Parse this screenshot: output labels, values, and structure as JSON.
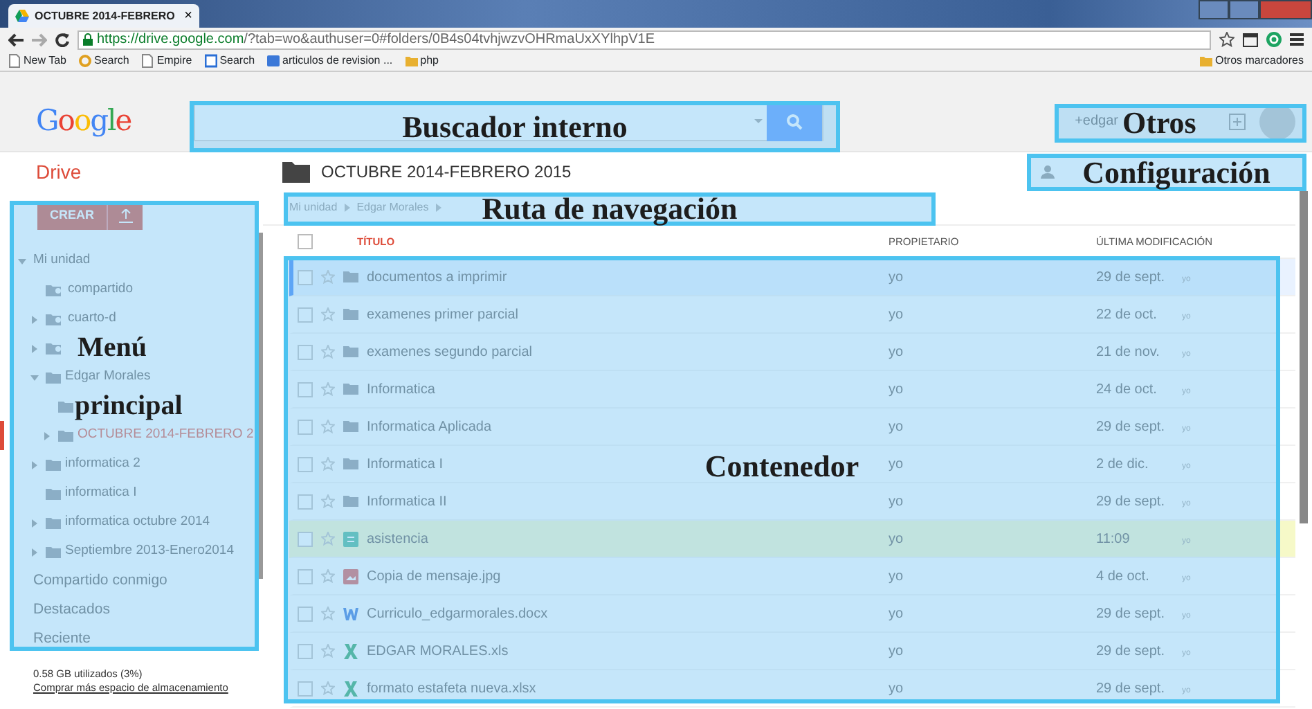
{
  "browser": {
    "tab": {
      "title": "OCTUBRE 2014-FEBRERO",
      "close": "×"
    },
    "url": {
      "host": "https://drive.google.com",
      "path": "/?tab=wo&authuser=0#folders/0B4s04tvhjwzvOHRmaUxXYlhpV1E"
    },
    "bookmarks": [
      {
        "label": "New Tab",
        "kind": "page"
      },
      {
        "label": "Search",
        "kind": "circle"
      },
      {
        "label": "Empire",
        "kind": "page"
      },
      {
        "label": "Search",
        "kind": "board"
      },
      {
        "label": "articulos de revision ...",
        "kind": "app"
      },
      {
        "label": "php",
        "kind": "folder"
      }
    ],
    "other_bookmarks": "Otros marcadores"
  },
  "header": {
    "logo": "Google",
    "user": "+edgar"
  },
  "app": {
    "name": "Drive",
    "folder_title": "OCTUBRE 2014-FEBRERO 2015"
  },
  "sidebar": {
    "create_button": "CREAR",
    "tree": [
      {
        "label": "Mi unidad",
        "expandable": true,
        "expanded": true,
        "selected": false,
        "children": [
          {
            "label": "compartido",
            "kind": "shared",
            "expandable": false,
            "selected": false
          },
          {
            "label": "cuarto-d",
            "kind": "shared",
            "expandable": true,
            "expanded": false,
            "selected": false
          },
          {
            "kind": "shared",
            "expandable": true,
            "expanded": false,
            "selected": false
          },
          {
            "label": "Edgar Morales",
            "kind": "folder",
            "expandable": true,
            "expanded": true,
            "selected": false,
            "children": [
              {
                "kind": "folder",
                "expandable": false,
                "selected": false
              },
              {
                "label": "OCTUBRE 2014-FEBRERO 2",
                "kind": "folder",
                "expandable": true,
                "expanded": false,
                "selected": true
              }
            ]
          },
          {
            "label": "informatica 2",
            "kind": "folder",
            "expandable": true,
            "expanded": false,
            "selected": false
          },
          {
            "label": "informatica I",
            "kind": "folder",
            "expandable": false,
            "selected": false
          },
          {
            "label": "informatica octubre 2014",
            "kind": "folder",
            "expandable": true,
            "expanded": false,
            "selected": false
          },
          {
            "label": "Septiembre 2013-Enero2014",
            "kind": "folder",
            "expandable": true,
            "expanded": false,
            "selected": false
          }
        ]
      }
    ],
    "links": [
      "Compartido conmigo",
      "Destacados",
      "Reciente"
    ],
    "storage": {
      "usage": "0.58 GB utilizados (3%)",
      "buy_link": "Comprar más espacio de almacenamiento"
    }
  },
  "breadcrumb": [
    "Mi unidad",
    "Edgar Morales"
  ],
  "table": {
    "select_all_checked": false,
    "columns": [
      "TÍTULO",
      "PROPIETARIO",
      "ÚLTIMA MODIFICACIÓN"
    ],
    "rows": [
      {
        "title": "documentos a imprimir",
        "kind": "folder",
        "owner": "yo",
        "modified": "29 de sept.",
        "modified_by": "yo",
        "selected": true,
        "highlighted": false
      },
      {
        "title": "examenes primer parcial",
        "kind": "folder",
        "owner": "yo",
        "modified": "22 de oct.",
        "modified_by": "yo",
        "selected": false,
        "highlighted": false
      },
      {
        "title": "examenes segundo parcial",
        "kind": "folder",
        "owner": "yo",
        "modified": "21 de nov.",
        "modified_by": "yo",
        "selected": false,
        "highlighted": false
      },
      {
        "title": "Informatica",
        "kind": "folder",
        "owner": "yo",
        "modified": "24 de oct.",
        "modified_by": "yo",
        "selected": false,
        "highlighted": false
      },
      {
        "title": "Informatica Aplicada",
        "kind": "folder",
        "owner": "yo",
        "modified": "29 de sept.",
        "modified_by": "yo",
        "selected": false,
        "highlighted": false
      },
      {
        "title": "Informatica I",
        "kind": "folder",
        "owner": "yo",
        "modified": "2 de dic.",
        "modified_by": "yo",
        "selected": false,
        "highlighted": false
      },
      {
        "title": "Informatica II",
        "kind": "folder",
        "owner": "yo",
        "modified": "29 de sept.",
        "modified_by": "yo",
        "selected": false,
        "highlighted": false
      },
      {
        "title": "asistencia",
        "kind": "sheet",
        "owner": "yo",
        "modified": "11:09",
        "modified_by": "yo",
        "selected": false,
        "highlighted": true
      },
      {
        "title": "Copia de mensaje.jpg",
        "kind": "image",
        "owner": "yo",
        "modified": "4 de oct.",
        "modified_by": "yo",
        "selected": false,
        "highlighted": false
      },
      {
        "title": "Curriculo_edgarmorales.docx",
        "kind": "word",
        "owner": "yo",
        "modified": "29 de sept.",
        "modified_by": "yo",
        "selected": false,
        "highlighted": false
      },
      {
        "title": "EDGAR MORALES.xls",
        "kind": "excel",
        "owner": "yo",
        "modified": "29 de sept.",
        "modified_by": "yo",
        "selected": false,
        "highlighted": false
      },
      {
        "title": "formato estafeta nueva.xlsx",
        "kind": "excel",
        "owner": "yo",
        "modified": "29 de sept.",
        "modified_by": "yo",
        "selected": false,
        "highlighted": false
      }
    ]
  },
  "annotations": [
    {
      "lines": [
        "Buscador interno"
      ]
    },
    {
      "lines": [
        "Otros"
      ]
    },
    {
      "lines": [
        "Configuración"
      ]
    },
    {
      "lines": [
        "Ruta de navegación"
      ]
    },
    {
      "lines": [
        "Menú",
        "principal"
      ]
    },
    {
      "lines": [
        "Contenedor"
      ]
    }
  ]
}
